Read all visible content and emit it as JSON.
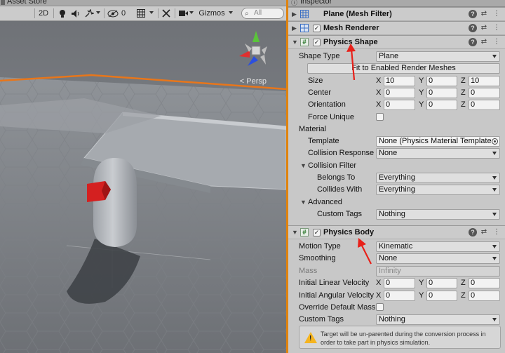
{
  "scene_tab": {
    "label": "Asset Store"
  },
  "scene_toolbar": {
    "mode_2d": "2D",
    "hidden_count": "0",
    "gizmos": "Gizmos",
    "search_placeholder": "All"
  },
  "scene": {
    "persp_label": "< Persp"
  },
  "inspector": {
    "tab_label": "Inspector",
    "components": [
      {
        "title": "Plane (Mesh Filter)"
      },
      {
        "title": "Mesh Renderer",
        "enabled": true
      },
      {
        "title": "Physics Shape",
        "enabled": true
      },
      {
        "title": "Physics Body",
        "enabled": true
      }
    ]
  },
  "physics_shape": {
    "shape_type_label": "Shape Type",
    "shape_type_value": "Plane",
    "fit_button": "Fit to Enabled Render Meshes",
    "size_label": "Size",
    "size": {
      "x": "10",
      "y": "0",
      "z": "10"
    },
    "center_label": "Center",
    "center": {
      "x": "0",
      "y": "0",
      "z": "0"
    },
    "orientation_label": "Orientation",
    "orientation": {
      "x": "0",
      "y": "0",
      "z": "0"
    },
    "force_unique_label": "Force Unique",
    "material_label": "Material",
    "template_label": "Template",
    "template_value": "None (Physics Material Template",
    "collision_response_label": "Collision Response",
    "collision_response_value": "None",
    "collision_filter_label": "Collision Filter",
    "belongs_to_label": "Belongs To",
    "belongs_to_value": "Everything",
    "collides_with_label": "Collides With",
    "collides_with_value": "Everything",
    "advanced_label": "Advanced",
    "custom_tags_label": "Custom Tags",
    "custom_tags_value": "Nothing"
  },
  "physics_body": {
    "motion_type_label": "Motion Type",
    "motion_type_value": "Kinematic",
    "smoothing_label": "Smoothing",
    "smoothing_value": "None",
    "mass_label": "Mass",
    "mass_value": "Infinity",
    "linear_velocity_label": "Initial Linear Velocity",
    "linear_velocity": {
      "x": "0",
      "y": "0",
      "z": "0"
    },
    "angular_velocity_label": "Initial Angular Velocity",
    "angular_velocity": {
      "x": "0",
      "y": "0",
      "z": "0"
    },
    "override_mass_label": "Override Default Mass",
    "custom_tags_label": "Custom Tags",
    "custom_tags_value": "Nothing",
    "warning": "Target will be un-parented during the conversion process in order to take part in physics simulation."
  },
  "axes": {
    "x": "X",
    "y": "Y",
    "z": "Z"
  },
  "colors": {
    "accent_orange": "#e0830e",
    "annotation_red": "#e8211a",
    "warning_yellow": "#f5b41f"
  }
}
